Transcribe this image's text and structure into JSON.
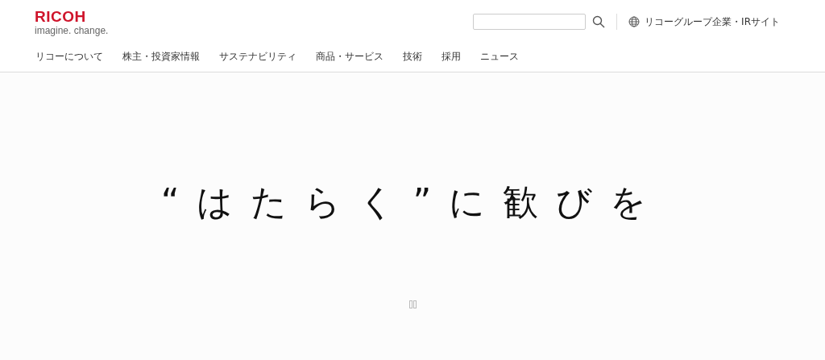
{
  "logo": {
    "wordmark": "RICOH",
    "tagline": "imagine. change."
  },
  "group_link": "リコーグループ企業・IRサイト",
  "nav": [
    "リコーについて",
    "株主・投資家情報",
    "サステナビリティ",
    "商品・サービス",
    "技術",
    "採用",
    "ニュース"
  ],
  "hero": {
    "headline": "“はたらく”に歓びを"
  }
}
